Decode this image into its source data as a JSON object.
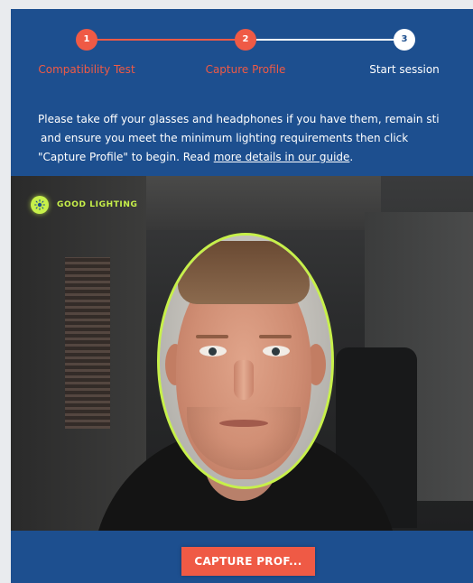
{
  "stepper": {
    "steps": [
      {
        "number": "1",
        "label": "Compatibility Test",
        "state": "done"
      },
      {
        "number": "2",
        "label": "Capture Profile",
        "state": "done"
      },
      {
        "number": "3",
        "label": "Start session",
        "state": "current"
      }
    ]
  },
  "instructions": {
    "line1": "Please take off your glasses and headphones if you have them, remain sti",
    "line2": "and ensure you meet the minimum lighting requirements then click",
    "line3_prefix": "\"Capture Profile\" to begin. Read ",
    "link": "more details in our guide",
    "line3_suffix": "."
  },
  "camera": {
    "lighting_status": "GOOD LIGHTING",
    "lighting_icon": "sun-icon"
  },
  "actions": {
    "capture_label": "CAPTURE PROF..."
  },
  "colors": {
    "brand_blue": "#1d4f8f",
    "accent_orange": "#ef5a45",
    "status_green": "#c7f04a"
  }
}
